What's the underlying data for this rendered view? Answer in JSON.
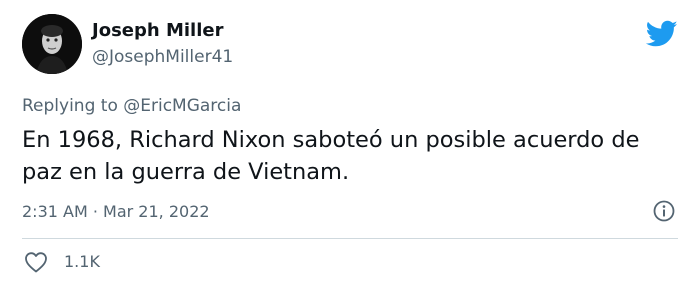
{
  "author": {
    "name": "Joseph Miller",
    "handle": "@JosephMiller41"
  },
  "reply": {
    "prefix": "Replying to",
    "mention": "@EricMGarcia"
  },
  "tweet": {
    "text": "En 1968, Richard Nixon saboteó un posible acuerdo de paz en la guerra de Vietnam.",
    "timestamp": "2:31 AM · Mar 21, 2022"
  },
  "stats": {
    "likes": "1.1K"
  },
  "icons": {
    "brand": "twitter-bird-icon",
    "info": "info-icon",
    "like": "heart-icon"
  },
  "colors": {
    "brand": "#1d9bf0",
    "text": "#0f1419",
    "secondary": "#536471",
    "divider": "#cfd9de"
  }
}
